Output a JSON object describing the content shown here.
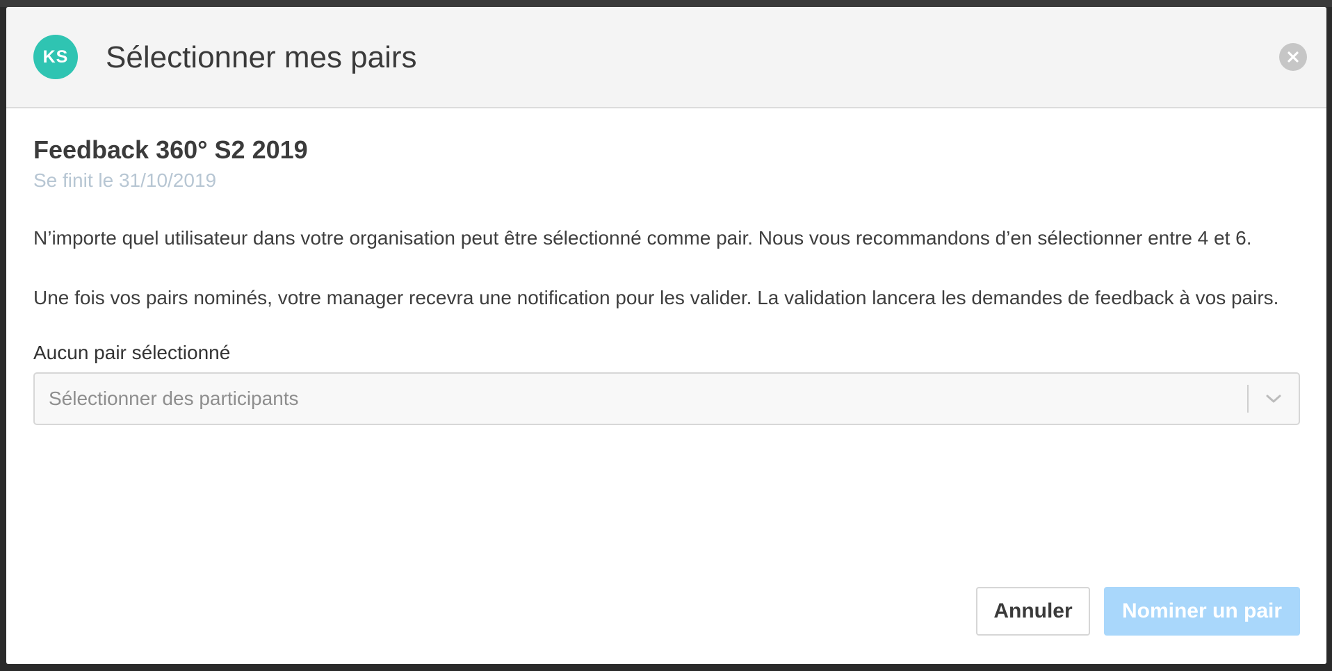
{
  "modal": {
    "avatar_initials": "KS",
    "title": "Sélectionner mes pairs",
    "campaign": {
      "title": "Feedback 360° S2 2019",
      "deadline": "Se finit le 31/10/2019"
    },
    "paragraphs": [
      "N’importe quel utilisateur dans votre organisation peut être sélectionné comme pair. Nous vous recommandons d’en sélectionner entre 4 et 6.",
      "Une fois vos pairs nominés, votre manager recevra une notification pour les valider. La validation lancera les demandes de feedback à vos pairs."
    ],
    "selection": {
      "label": "Aucun pair sélectionné",
      "placeholder": "Sélectionner des participants"
    },
    "buttons": {
      "cancel": "Annuler",
      "submit": "Nominer un pair"
    }
  },
  "colors": {
    "avatar": "#2fc4b2",
    "primary_button_disabled": "#a9d7fb",
    "deadline_text": "#b7c6d3",
    "header_background": "#f4f4f4"
  },
  "icons": {
    "close": "close-icon",
    "dropdown": "chevron-down-icon"
  }
}
